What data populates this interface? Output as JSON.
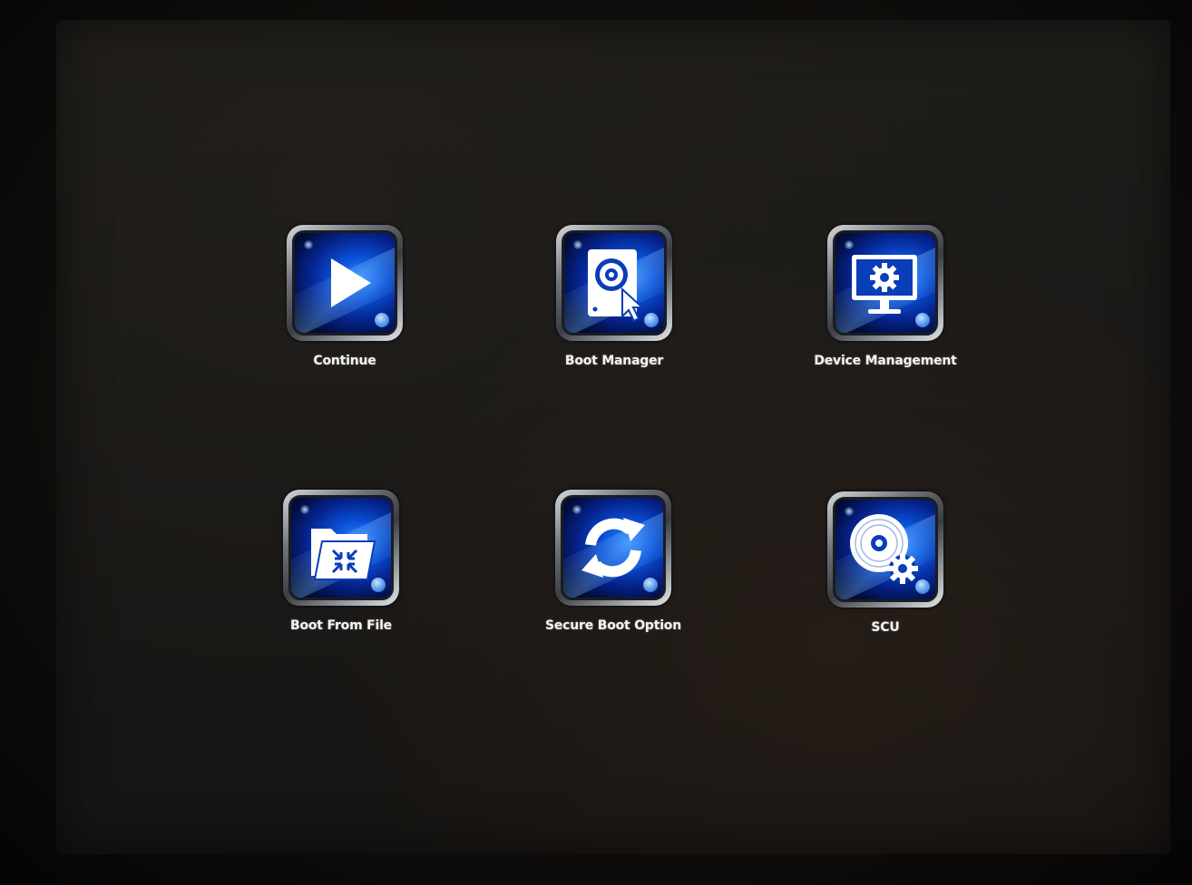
{
  "menu": {
    "items": [
      {
        "label": "Continue",
        "icon": "play-icon"
      },
      {
        "label": "Boot Manager",
        "icon": "disk-cursor-icon"
      },
      {
        "label": "Device Management",
        "icon": "monitor-gear-icon"
      },
      {
        "label": "Boot From File",
        "icon": "folder-arrows-icon"
      },
      {
        "label": "Secure Boot Option",
        "icon": "refresh-icon"
      },
      {
        "label": "SCU",
        "icon": "disc-gear-icon"
      }
    ]
  },
  "colors": {
    "tile_blue": "#0a4fd6",
    "label": "#f4f4f4",
    "background": "#1b1917"
  }
}
